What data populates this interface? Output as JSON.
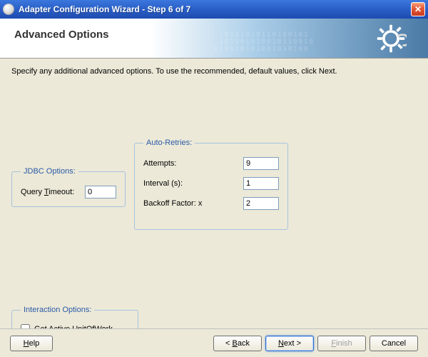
{
  "window": {
    "title": "Adapter Configuration Wizard - Step 6 of 7"
  },
  "header": {
    "heading": "Advanced Options"
  },
  "instruction": "Specify any additional advanced options.  To use the recommended, default values, click Next.",
  "jdbc": {
    "legend": "JDBC Options:",
    "queryTimeout_pre": "Query ",
    "queryTimeout_u": "T",
    "queryTimeout_post": "imeout:",
    "queryTimeout_value": "0"
  },
  "auto": {
    "legend": "Auto-Retries:",
    "attempts_label": "Attempts:",
    "attempts_value": "9",
    "interval_label": "Interval (s):",
    "interval_value": "1",
    "backoff_label": "Backoff Factor: x",
    "backoff_value": "2"
  },
  "inter": {
    "legend": "Interaction Options:",
    "getActive_label": "Get Active UnitOfWork"
  },
  "buttons": {
    "help_u": "H",
    "help_post": "elp",
    "back_pre": "< ",
    "back_u": "B",
    "back_post": "ack",
    "next_u": "N",
    "next_post": "ext >",
    "finish_u": "F",
    "finish_post": "inish",
    "cancel": "Cancel"
  }
}
